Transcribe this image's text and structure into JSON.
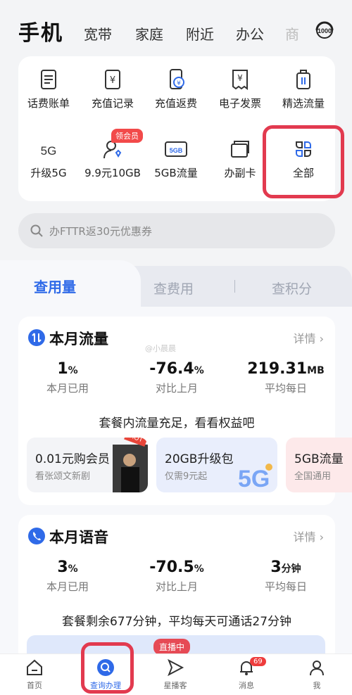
{
  "header": {
    "tabs": [
      "手机",
      "宽带",
      "家庭",
      "附近",
      "办公",
      "商"
    ]
  },
  "quick_grid": {
    "row1": [
      "话费账单",
      "充值记录",
      "充值返费",
      "电子发票",
      "精选流量"
    ],
    "row2": [
      "升级5G",
      "9.9元10GB",
      "5GB流量",
      "办副卡",
      "全部"
    ],
    "vip_badge": "领会员",
    "sim_label": "5GB",
    "fiveg_label": "5G"
  },
  "search": {
    "placeholder": "办FTTR返30元优惠券"
  },
  "segments": [
    "查用量",
    "查费用",
    "查积分"
  ],
  "data_card": {
    "title": "本月流量",
    "detail": "详情",
    "stats": [
      {
        "value": "1",
        "unit": "%",
        "label": "本月已用"
      },
      {
        "value": "-76.4",
        "unit": "%",
        "label": "对比上月"
      },
      {
        "value": "219.31",
        "unit": "MB",
        "label": "平均每日"
      }
    ],
    "summary": "套餐内流量充足，看看权益吧",
    "promos": [
      {
        "title": "0.01元购会员",
        "sub": "看张颂文新剧",
        "tag": "HOT"
      },
      {
        "title": "20GB升级包",
        "sub": "仅需9元起"
      },
      {
        "title": "5GB流量",
        "sub": "全国通用"
      }
    ]
  },
  "voice_card": {
    "title": "本月语音",
    "detail": "详情",
    "stats": [
      {
        "value": "3",
        "unit": "%",
        "label": "本月已用"
      },
      {
        "value": "-70.5",
        "unit": "%",
        "label": "对比上月"
      },
      {
        "value": "3",
        "unit": "分钟",
        "label": "平均每日"
      }
    ],
    "summary": "套餐剩余677分钟，平均每天可通话27分钟"
  },
  "live_badge": "直播中",
  "watermark": "@小晨晨",
  "tabbar": {
    "items": [
      "首页",
      "查询办理",
      "星播客",
      "消息",
      "我"
    ],
    "message_badge": "69"
  },
  "colors": {
    "accent": "#2f6ae8",
    "highlight": "#e23a4f"
  }
}
